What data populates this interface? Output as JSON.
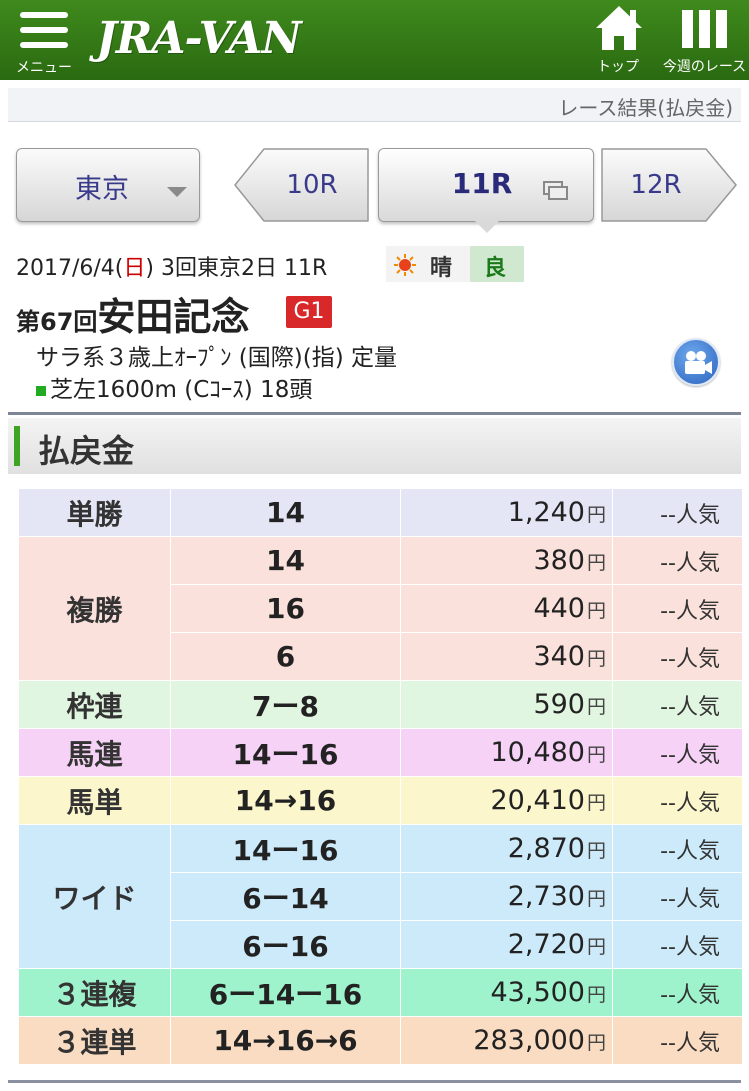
{
  "header": {
    "menu_label": "メニュー",
    "logo": "JRA-VAN",
    "top_label": "トップ",
    "week_label": "今週のレース",
    "bg_color": "#2f7615"
  },
  "subbar": {
    "title": "レース結果(払戻金)"
  },
  "nav": {
    "venue": "東京",
    "prev_race": "10R",
    "current_race": "11R",
    "next_race": "12R"
  },
  "race": {
    "date_prefix": "2017/6/4(",
    "weekday": "日",
    "date_suffix": ") 3回東京2日 11R",
    "weather": "晴",
    "track_condition": "良",
    "edition": "第67回",
    "name": "安田記念",
    "grade": "G1",
    "conditions": "サラ系３歳上ｵｰﾌﾟﾝ (国際)(指) 定量",
    "course": "芝左1600m (Cｺｰｽ) 18頭"
  },
  "section": {
    "title": "払戻金"
  },
  "payouts": [
    {
      "bet": "単勝",
      "color": "#e4e6f6",
      "rows": [
        {
          "combo": "14",
          "amount": "1,240",
          "pop": "--人気"
        }
      ]
    },
    {
      "bet": "複勝",
      "color": "#fbe1dc",
      "rows": [
        {
          "combo": "14",
          "amount": "380",
          "pop": "--人気"
        },
        {
          "combo": "16",
          "amount": "440",
          "pop": "--人気"
        },
        {
          "combo": "6",
          "amount": "340",
          "pop": "--人気"
        }
      ]
    },
    {
      "bet": "枠連",
      "color": "#e1f6e1",
      "rows": [
        {
          "combo": "7ー8",
          "amount": "590",
          "pop": "--人気"
        }
      ]
    },
    {
      "bet": "馬連",
      "color": "#f6d2f6",
      "rows": [
        {
          "combo": "14ー16",
          "amount": "10,480",
          "pop": "--人気"
        }
      ]
    },
    {
      "bet": "馬単",
      "color": "#fbf6cc",
      "rows": [
        {
          "combo": "14→16",
          "amount": "20,410",
          "pop": "--人気"
        }
      ]
    },
    {
      "bet": "ワイド",
      "color": "#cdeafa",
      "rows": [
        {
          "combo": "14ー16",
          "amount": "2,870",
          "pop": "--人気"
        },
        {
          "combo": "6ー14",
          "amount": "2,730",
          "pop": "--人気"
        },
        {
          "combo": "6ー16",
          "amount": "2,720",
          "pop": "--人気"
        }
      ]
    },
    {
      "bet": "３連複",
      "color": "#9ef2cc",
      "rows": [
        {
          "combo": "6ー14ー16",
          "amount": "43,500",
          "pop": "--人気"
        }
      ]
    },
    {
      "bet": "３連単",
      "color": "#f9dcc2",
      "rows": [
        {
          "combo": "14→16→6",
          "amount": "283,000",
          "pop": "--人気"
        }
      ]
    }
  ],
  "yen": "円"
}
